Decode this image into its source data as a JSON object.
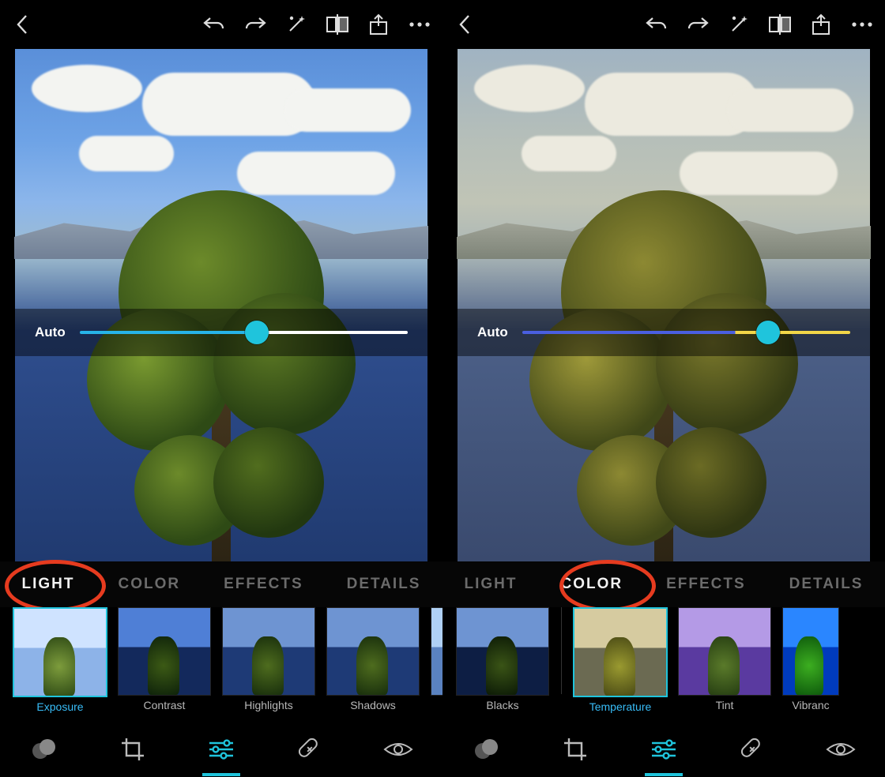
{
  "left": {
    "slider": {
      "auto_label": "Auto"
    },
    "tabs": {
      "light": "LIGHT",
      "color": "COLOR",
      "effects": "EFFECTS",
      "details": "DETAILS",
      "active": "light"
    },
    "thumbs": [
      {
        "label": "Exposure",
        "selected": true
      },
      {
        "label": "Contrast",
        "selected": false
      },
      {
        "label": "Highlights",
        "selected": false
      },
      {
        "label": "Shadows",
        "selected": false
      }
    ]
  },
  "right": {
    "slider": {
      "auto_label": "Auto"
    },
    "tabs": {
      "light": "LIGHT",
      "color": "COLOR",
      "effects": "EFFECTS",
      "details": "DETAILS",
      "active": "color"
    },
    "thumbs": [
      {
        "label": "Blacks",
        "selected": false
      },
      {
        "label": "Temperature",
        "selected": true
      },
      {
        "label": "Tint",
        "selected": false
      },
      {
        "label": "Vibranc",
        "selected": false
      }
    ]
  },
  "colors": {
    "accent": "#1fc4dc",
    "annot": "#e63b1f"
  }
}
